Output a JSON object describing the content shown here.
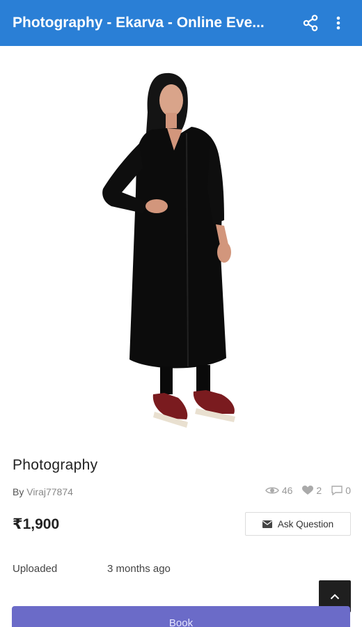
{
  "appbar": {
    "title": "Photography - Ekarva - Online Eve...",
    "color": "#2a7fd6",
    "share_icon": "share-icon",
    "more_icon": "more-vert-icon"
  },
  "product": {
    "image_alt": "Woman wearing black kurta with red sandals",
    "title": "Photography",
    "by_prefix": "By",
    "seller": "Viraj77874",
    "views": "46",
    "likes": "2",
    "comments": "0",
    "price": "₹1,900",
    "ask_question": "Ask Question"
  },
  "details": {
    "uploaded_label": "Uploaded",
    "uploaded_value": "3 months ago"
  },
  "actions": {
    "book_label": "Book",
    "book_color": "#6b6bc8"
  }
}
